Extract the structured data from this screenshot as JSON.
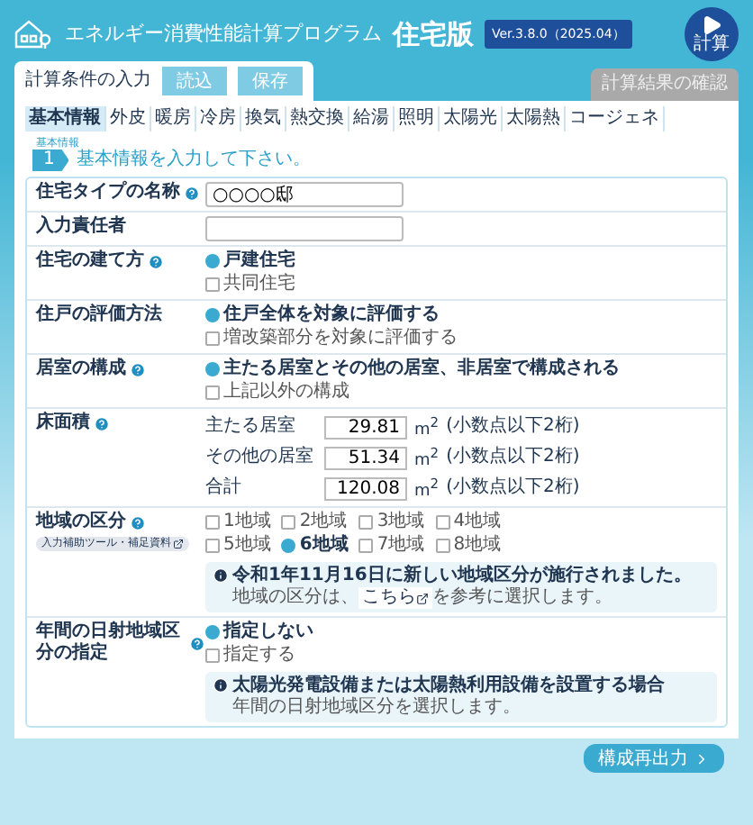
{
  "header": {
    "title": "エネルギー消費性能計算プログラム",
    "edition": "住宅版",
    "version": "Ver.3.8.0（2025.04）",
    "calc_button": "計算"
  },
  "main_tabs": [
    {
      "label": "計算条件の入力",
      "selected": true
    },
    {
      "label": "計算結果の確認",
      "selected": false
    }
  ],
  "file_buttons": [
    "読込",
    "保存"
  ],
  "sub_tabs": [
    {
      "label": "基本情報",
      "selected": true
    },
    {
      "label": "外皮",
      "selected": false
    },
    {
      "label": "暖房",
      "selected": false
    },
    {
      "label": "冷房",
      "selected": false
    },
    {
      "label": "換気",
      "selected": false
    },
    {
      "label": "熱交換",
      "selected": false
    },
    {
      "label": "給湯",
      "selected": false
    },
    {
      "label": "照明",
      "selected": false
    },
    {
      "label": "太陽光",
      "selected": false
    },
    {
      "label": "太陽熱",
      "selected": false
    },
    {
      "label": "コージェネ",
      "selected": false
    }
  ],
  "section": {
    "caption": "基本情報",
    "number": "1",
    "title": "基本情報を入力して下さい。"
  },
  "rows": [
    {
      "kind": "text",
      "label": "住宅タイプの名称",
      "help": true,
      "value": "○○○○邸"
    },
    {
      "kind": "text",
      "label": "入力責任者",
      "help": false
    },
    {
      "kind": "radio",
      "label": "住宅の建て方",
      "help": true,
      "options": [
        {
          "label": "戸建住宅",
          "selected": true
        },
        {
          "label": "共同住宅",
          "selected": false
        }
      ]
    },
    {
      "kind": "radio",
      "label": "住戸の評価方法",
      "help": false,
      "options": [
        {
          "label": "住戸全体を対象に評価する",
          "selected": true
        },
        {
          "label": "増改築部分を対象に評価する",
          "selected": false
        }
      ]
    },
    {
      "kind": "radio",
      "label": "居室の構成",
      "help": true,
      "options": [
        {
          "label": "主たる居室とその他の居室、非居室で構成される",
          "selected": true
        },
        {
          "label": "上記以外の構成",
          "selected": false
        }
      ]
    },
    {
      "kind": "area",
      "label": "床面積",
      "help": true,
      "fields": [
        {
          "label": "主たる居室",
          "value": "29.81",
          "unit": "m$^{2}$",
          "note": "(小数点以下2桁)"
        },
        {
          "label": "その他の居室",
          "value": "51.34",
          "unit": "m$^{2}$",
          "note": "(小数点以下2桁)"
        },
        {
          "label": "合計",
          "value": "120.08",
          "unit": "m$^{2}$",
          "note": "(小数点以下2桁)"
        }
      ]
    },
    {
      "kind": "region",
      "label": "地域の区分",
      "help": true,
      "badge": "入力補助ツール・補足資料",
      "options": [
        {
          "label": "1地域",
          "selected": false
        },
        {
          "label": "2地域",
          "selected": false
        },
        {
          "label": "3地域",
          "selected": false
        },
        {
          "label": "4地域",
          "selected": false
        },
        {
          "label": "5地域",
          "selected": false
        },
        {
          "label": "6地域",
          "selected": true
        },
        {
          "label": "7地域",
          "selected": false
        },
        {
          "label": "8地域",
          "selected": false
        }
      ],
      "info": {
        "title": "令和1年11月16日に新しい地域区分が施行されました。",
        "text_before": "地域の区分は、",
        "link": "こちら",
        "text_after": "を参考に選択します。"
      }
    },
    {
      "kind": "radio",
      "label": "年間の日射地域区分の指定",
      "help": true,
      "options": [
        {
          "label": "指定しない",
          "selected": true
        },
        {
          "label": "指定する",
          "selected": false
        }
      ],
      "info": {
        "title": "太陽光発電設備または太陽熱利用設備を設置する場合",
        "text_before": "年間の日射地域区分を選択します。"
      }
    }
  ],
  "footer_button": "構成再出力"
}
